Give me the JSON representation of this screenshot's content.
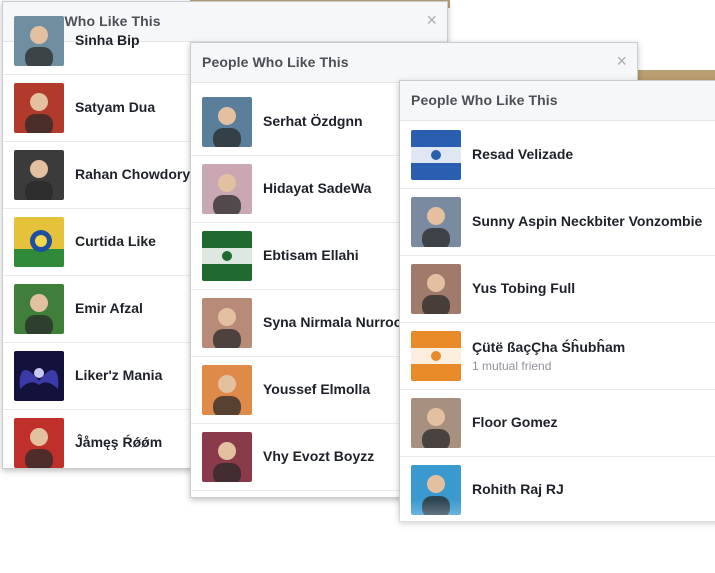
{
  "dialogs": [
    {
      "title": "People Who Like This",
      "close_label": "×",
      "people": [
        {
          "name": "Sinha Bip",
          "avatar": "avatar-person",
          "color": "#6f8fa0"
        },
        {
          "name": "Satyam Dua",
          "avatar": "avatar-person",
          "color": "#b13a2a"
        },
        {
          "name": "Rahan Chowdory",
          "avatar": "avatar-person",
          "color": "#3b3b3b"
        },
        {
          "name": "Curtida Like",
          "avatar": "avatar-like-logo",
          "color": "#e5c23a"
        },
        {
          "name": "Emir Afzal",
          "avatar": "avatar-person",
          "color": "#3f7f3a"
        },
        {
          "name": "Liker'z Mania",
          "avatar": "avatar-wings",
          "color": "#3a3aa8"
        },
        {
          "name": "Ĵåmęş Ŕǿǿm",
          "avatar": "avatar-person",
          "color": "#c0302a"
        }
      ]
    },
    {
      "title": "People Who Like This",
      "close_label": "×",
      "people": [
        {
          "name": "Serhat Özdgnn",
          "avatar": "avatar-person",
          "color": "#5a7f9a"
        },
        {
          "name": "Hidayat SadeWa",
          "avatar": "avatar-person",
          "color": "#c9a8b4"
        },
        {
          "name": "Ebtisam Ellahi",
          "avatar": "avatar-flag",
          "color": "#1f6b2f"
        },
        {
          "name": "Syna Nirmala Nurrochmah",
          "avatar": "avatar-person",
          "color": "#b88a78"
        },
        {
          "name": "Youssef Elmolla",
          "avatar": "avatar-person",
          "color": "#e08a4a"
        },
        {
          "name": "Vhy Evozt Boyzz",
          "avatar": "avatar-person",
          "color": "#8a3a4a"
        }
      ]
    },
    {
      "title": "People Who Like This",
      "close_label": "",
      "people": [
        {
          "name": "Resad Velizade",
          "avatar": "avatar-flag",
          "color": "#2a5fb0"
        },
        {
          "name": "Sunny Aspin Neckbiter Vonzombie",
          "avatar": "avatar-person",
          "color": "#7a8aa0"
        },
        {
          "name": "Yus Tobing Full",
          "avatar": "avatar-person",
          "color": "#a07a6a"
        },
        {
          "name": "Çütë ßaçÇha Śĥubĥam",
          "sub": "1 mutual friend",
          "avatar": "avatar-flag",
          "color": "#e88a2a"
        },
        {
          "name": "Floor Gomez",
          "avatar": "avatar-person",
          "color": "#a89080"
        },
        {
          "name": "Rohith Raj RJ",
          "avatar": "avatar-person",
          "color": "#3a9ad0"
        }
      ]
    }
  ]
}
